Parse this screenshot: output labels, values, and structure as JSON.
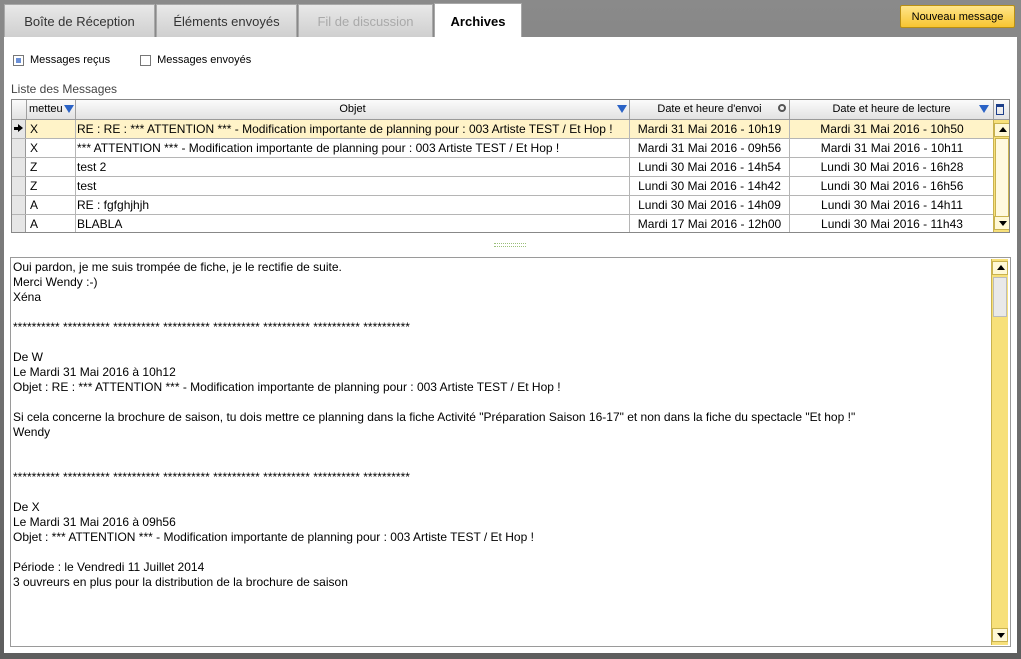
{
  "tabs": [
    {
      "label": "Boîte de Réception"
    },
    {
      "label": "Éléments envoyés"
    },
    {
      "label": "Fil de discussion"
    },
    {
      "label": "Archives"
    }
  ],
  "new_message_label": "Nouveau message",
  "filters": {
    "received_label": "Messages reçus",
    "received_checked": true,
    "sent_label": "Messages envoyés",
    "sent_checked": false
  },
  "list_title": "Liste des Messages",
  "columns": {
    "sender": "metteu",
    "subject": "Objet",
    "sent": "Date et heure d'envoi",
    "read": "Date et heure de lecture"
  },
  "rows": [
    {
      "sender": "X",
      "subject": "RE : RE : *** ATTENTION *** - Modification importante de planning pour : 003 Artiste TEST / Et Hop !",
      "sent": "Mardi 31 Mai 2016 - 10h19",
      "read": "Mardi 31 Mai 2016  -  10h50"
    },
    {
      "sender": "X",
      "subject": "*** ATTENTION *** - Modification importante de planning pour : 003 Artiste TEST / Et Hop !",
      "sent": "Mardi 31 Mai 2016 - 09h56",
      "read": "Mardi 31 Mai 2016  -  10h11"
    },
    {
      "sender": "Z",
      "subject": "test 2",
      "sent": "Lundi 30 Mai 2016 - 14h54",
      "read": "Lundi 30 Mai 2016  -  16h28"
    },
    {
      "sender": "Z",
      "subject": "test",
      "sent": "Lundi 30 Mai 2016 - 14h42",
      "read": "Lundi 30 Mai 2016  -  16h56"
    },
    {
      "sender": "A",
      "subject": "RE : fgfghjhjh",
      "sent": "Lundi 30 Mai 2016 - 14h09",
      "read": "Lundi 30 Mai 2016  -  14h11"
    },
    {
      "sender": "A",
      "subject": "BLABLA",
      "sent": "Mardi 17 Mai 2016 - 12h00",
      "read": "Lundi 30 Mai 2016  -  11h43"
    }
  ],
  "message_body": "Oui pardon, je me suis trompée de fiche, je le rectifie de suite.\nMerci Wendy :-)\nXéna\n\n********** ********** ********** ********** ********** ********** ********** **********\n\nDe W\nLe Mardi 31 Mai 2016 à 10h12\nObjet : RE : *** ATTENTION *** - Modification importante de planning pour : 003 Artiste TEST / Et Hop !\n\nSi cela concerne la brochure de saison, tu dois mettre ce planning dans la fiche Activité \"Préparation Saison 16-17\" et non dans la fiche du spectacle \"Et hop !\"\nWendy\n\n\n********** ********** ********** ********** ********** ********** ********** **********\n\nDe X\nLe Mardi 31 Mai 2016 à 09h56\nObjet : *** ATTENTION *** - Modification importante de planning pour : 003 Artiste TEST / Et Hop !\n\nPériode : le Vendredi 11 Juillet 2014\n3 ouvreurs en plus pour la distribution de la brochure de saison"
}
